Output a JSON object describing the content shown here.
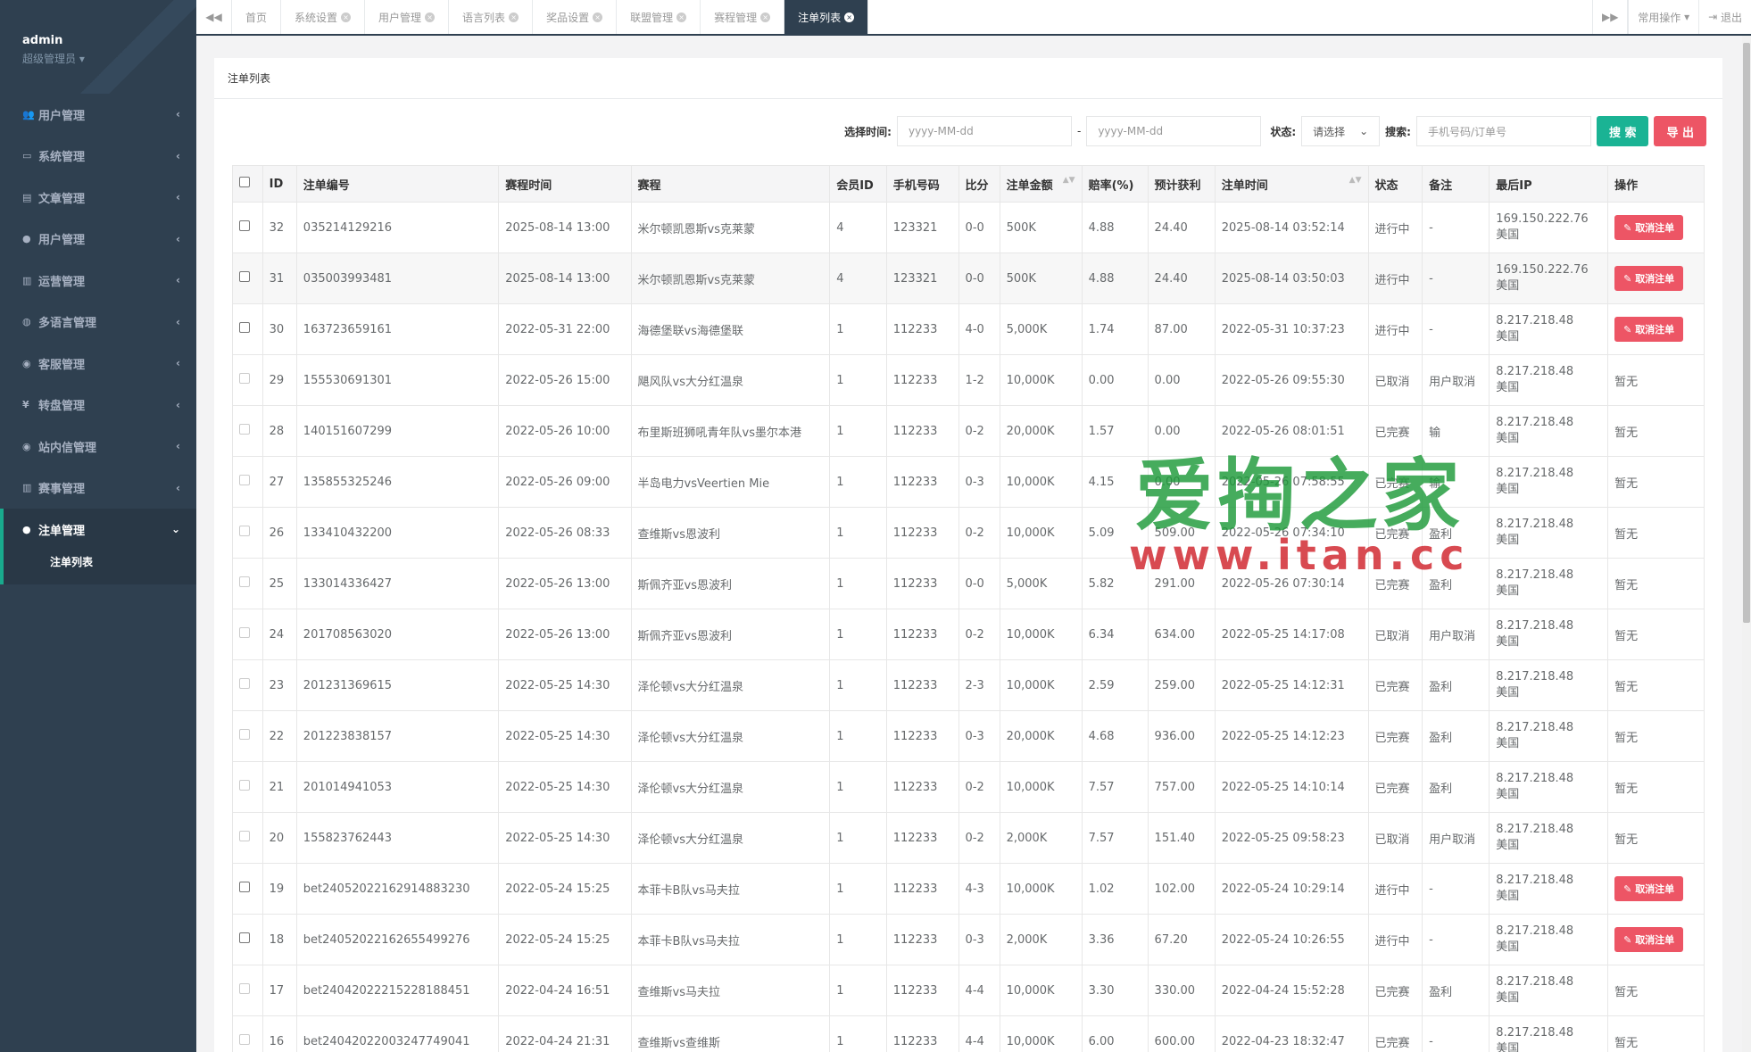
{
  "sidebar": {
    "user": "admin",
    "role": "超级管理员",
    "menu": [
      {
        "label": "用户管理",
        "icon": "users-icon",
        "glyph": "👥"
      },
      {
        "label": "系统管理",
        "icon": "monitor-icon",
        "glyph": "▭"
      },
      {
        "label": "文章管理",
        "icon": "book-icon",
        "glyph": "▤"
      },
      {
        "label": "用户管理",
        "icon": "user-icon",
        "glyph": "●"
      },
      {
        "label": "运营管理",
        "icon": "bar-chart-icon",
        "glyph": "▥"
      },
      {
        "label": "多语言管理",
        "icon": "globe-icon",
        "glyph": "◍"
      },
      {
        "label": "客服管理",
        "icon": "comment-icon",
        "glyph": "◉"
      },
      {
        "label": "转盘管理",
        "icon": "yen-icon",
        "glyph": "¥"
      },
      {
        "label": "站内信管理",
        "icon": "comment-icon",
        "glyph": "◉"
      },
      {
        "label": "赛事管理",
        "icon": "bar-chart-icon",
        "glyph": "▥"
      },
      {
        "label": "注单管理",
        "icon": "user-icon",
        "glyph": "●",
        "active": true
      }
    ],
    "submenu": [
      "注单列表"
    ]
  },
  "tabs": [
    {
      "label": "首页",
      "closable": false
    },
    {
      "label": "系统设置",
      "closable": true
    },
    {
      "label": "用户管理",
      "closable": true
    },
    {
      "label": "语言列表",
      "closable": true
    },
    {
      "label": "奖品设置",
      "closable": true
    },
    {
      "label": "联盟管理",
      "closable": true
    },
    {
      "label": "赛程管理",
      "closable": true
    },
    {
      "label": "注单列表",
      "closable": true,
      "active": true
    }
  ],
  "topbar": {
    "ops_label": "常用操作",
    "logout_label": "退出"
  },
  "panel": {
    "title": "注单列表"
  },
  "filter": {
    "time_label": "选择时间:",
    "date_placeholder": "yyyy-MM-dd",
    "dash": "-",
    "status_label": "状态:",
    "status_value": "请选择",
    "search_label": "搜索:",
    "search_placeholder": "手机号码/订单号",
    "search_button": "搜 索",
    "export_button": "导 出"
  },
  "table": {
    "headers": [
      "ID",
      "注单编号",
      "赛程时间",
      "赛程",
      "会员ID",
      "手机号码",
      "比分",
      "注单金额",
      "赔率(%)",
      "预计获利",
      "注单时间",
      "状态",
      "备注",
      "最后IP",
      "操作"
    ],
    "cancel_label": "取消注单",
    "rows": [
      {
        "id": "32",
        "no": "035214129216",
        "match_time": "2025-08-14 13:00",
        "match": "米尔顿凯恩斯vs克莱蒙",
        "member": "4",
        "phone": "123321",
        "score": "0-0",
        "amount": "500K",
        "odds": "4.88",
        "profit": "24.40",
        "bet_time": "2025-08-14 03:52:14",
        "status": "进行中",
        "note": "-",
        "ip": "169.150.222.76",
        "region": "美国",
        "action": "cancel"
      },
      {
        "id": "31",
        "no": "035003993481",
        "match_time": "2025-08-14 13:00",
        "match": "米尔顿凯恩斯vs克莱蒙",
        "member": "4",
        "phone": "123321",
        "score": "0-0",
        "amount": "500K",
        "odds": "4.88",
        "profit": "24.40",
        "bet_time": "2025-08-14 03:50:03",
        "status": "进行中",
        "note": "-",
        "ip": "169.150.222.76",
        "region": "美国",
        "action": "cancel"
      },
      {
        "id": "30",
        "no": "163723659161",
        "match_time": "2022-05-31 22:00",
        "match": "海德堡联vs海德堡联",
        "member": "1",
        "phone": "112233",
        "score": "4-0",
        "amount": "5,000K",
        "odds": "1.74",
        "profit": "87.00",
        "bet_time": "2022-05-31 10:37:23",
        "status": "进行中",
        "note": "-",
        "ip": "8.217.218.48",
        "region": "美国",
        "action": "cancel"
      },
      {
        "id": "29",
        "no": "155530691301",
        "match_time": "2022-05-26 15:00",
        "match": "飓风队vs大分红温泉",
        "member": "1",
        "phone": "112233",
        "score": "1-2",
        "amount": "10,000K",
        "odds": "0.00",
        "profit": "0.00",
        "bet_time": "2022-05-26 09:55:30",
        "status": "已取消",
        "note": "用户取消",
        "ip": "8.217.218.48",
        "region": "美国",
        "action": "暂无"
      },
      {
        "id": "28",
        "no": "140151607299",
        "match_time": "2022-05-26 10:00",
        "match": "布里斯班狮吼青年队vs墨尔本港",
        "member": "1",
        "phone": "112233",
        "score": "0-2",
        "amount": "20,000K",
        "odds": "1.57",
        "profit": "0.00",
        "bet_time": "2022-05-26 08:01:51",
        "status": "已完赛",
        "note": "输",
        "ip": "8.217.218.48",
        "region": "美国",
        "action": "暂无"
      },
      {
        "id": "27",
        "no": "135855325246",
        "match_time": "2022-05-26 09:00",
        "match": "半岛电力vsVeertien Mie",
        "member": "1",
        "phone": "112233",
        "score": "0-3",
        "amount": "10,000K",
        "odds": "4.15",
        "profit": "0.00",
        "bet_time": "2022-05-26 07:58:55",
        "status": "已完赛",
        "note": "输",
        "ip": "8.217.218.48",
        "region": "美国",
        "action": "暂无"
      },
      {
        "id": "26",
        "no": "133410432200",
        "match_time": "2022-05-26 08:33",
        "match": "查维斯vs恩波利",
        "member": "1",
        "phone": "112233",
        "score": "0-2",
        "amount": "10,000K",
        "odds": "5.09",
        "profit": "509.00",
        "bet_time": "2022-05-26 07:34:10",
        "status": "已完赛",
        "note": "盈利",
        "ip": "8.217.218.48",
        "region": "美国",
        "action": "暂无"
      },
      {
        "id": "25",
        "no": "133014336427",
        "match_time": "2022-05-26 13:00",
        "match": "斯佩齐亚vs恩波利",
        "member": "1",
        "phone": "112233",
        "score": "0-0",
        "amount": "5,000K",
        "odds": "5.82",
        "profit": "291.00",
        "bet_time": "2022-05-26 07:30:14",
        "status": "已完赛",
        "note": "盈利",
        "ip": "8.217.218.48",
        "region": "美国",
        "action": "暂无"
      },
      {
        "id": "24",
        "no": "201708563020",
        "match_time": "2022-05-26 13:00",
        "match": "斯佩齐亚vs恩波利",
        "member": "1",
        "phone": "112233",
        "score": "0-2",
        "amount": "10,000K",
        "odds": "6.34",
        "profit": "634.00",
        "bet_time": "2022-05-25 14:17:08",
        "status": "已取消",
        "note": "用户取消",
        "ip": "8.217.218.48",
        "region": "美国",
        "action": "暂无"
      },
      {
        "id": "23",
        "no": "201231369615",
        "match_time": "2022-05-25 14:30",
        "match": "泽伦顿vs大分红温泉",
        "member": "1",
        "phone": "112233",
        "score": "2-3",
        "amount": "10,000K",
        "odds": "2.59",
        "profit": "259.00",
        "bet_time": "2022-05-25 14:12:31",
        "status": "已完赛",
        "note": "盈利",
        "ip": "8.217.218.48",
        "region": "美国",
        "action": "暂无"
      },
      {
        "id": "22",
        "no": "201223838157",
        "match_time": "2022-05-25 14:30",
        "match": "泽伦顿vs大分红温泉",
        "member": "1",
        "phone": "112233",
        "score": "0-3",
        "amount": "20,000K",
        "odds": "4.68",
        "profit": "936.00",
        "bet_time": "2022-05-25 14:12:23",
        "status": "已完赛",
        "note": "盈利",
        "ip": "8.217.218.48",
        "region": "美国",
        "action": "暂无"
      },
      {
        "id": "21",
        "no": "201014941053",
        "match_time": "2022-05-25 14:30",
        "match": "泽伦顿vs大分红温泉",
        "member": "1",
        "phone": "112233",
        "score": "0-2",
        "amount": "10,000K",
        "odds": "7.57",
        "profit": "757.00",
        "bet_time": "2022-05-25 14:10:14",
        "status": "已完赛",
        "note": "盈利",
        "ip": "8.217.218.48",
        "region": "美国",
        "action": "暂无"
      },
      {
        "id": "20",
        "no": "155823762443",
        "match_time": "2022-05-25 14:30",
        "match": "泽伦顿vs大分红温泉",
        "member": "1",
        "phone": "112233",
        "score": "0-2",
        "amount": "2,000K",
        "odds": "7.57",
        "profit": "151.40",
        "bet_time": "2022-05-25 09:58:23",
        "status": "已取消",
        "note": "用户取消",
        "ip": "8.217.218.48",
        "region": "美国",
        "action": "暂无"
      },
      {
        "id": "19",
        "no": "bet24052022162914883230",
        "match_time": "2022-05-24 15:25",
        "match": "本菲卡B队vs马夫拉",
        "member": "1",
        "phone": "112233",
        "score": "4-3",
        "amount": "10,000K",
        "odds": "1.02",
        "profit": "102.00",
        "bet_time": "2022-05-24 10:29:14",
        "status": "进行中",
        "note": "-",
        "ip": "8.217.218.48",
        "region": "美国",
        "action": "cancel"
      },
      {
        "id": "18",
        "no": "bet24052022162655499276",
        "match_time": "2022-05-24 15:25",
        "match": "本菲卡B队vs马夫拉",
        "member": "1",
        "phone": "112233",
        "score": "0-3",
        "amount": "2,000K",
        "odds": "3.36",
        "profit": "67.20",
        "bet_time": "2022-05-24 10:26:55",
        "status": "进行中",
        "note": "-",
        "ip": "8.217.218.48",
        "region": "美国",
        "action": "cancel"
      },
      {
        "id": "17",
        "no": "bet24042022215228188451",
        "match_time": "2022-04-24 16:51",
        "match": "查维斯vs马夫拉",
        "member": "1",
        "phone": "112233",
        "score": "4-4",
        "amount": "10,000K",
        "odds": "3.30",
        "profit": "330.00",
        "bet_time": "2022-04-24 15:52:28",
        "status": "已完赛",
        "note": "盈利",
        "ip": "8.217.218.48",
        "region": "美国",
        "action": "暂无"
      },
      {
        "id": "16",
        "no": "bet24042022003247749041",
        "match_time": "2022-04-24 21:31",
        "match": "查维斯vs查维斯",
        "member": "1",
        "phone": "112233",
        "score": "4-4",
        "amount": "10,000K",
        "odds": "6.00",
        "profit": "600.00",
        "bet_time": "2022-04-23 18:32:47",
        "status": "已完赛",
        "note": "-",
        "ip": "8.217.218.48",
        "region": "美国",
        "action": "暂无"
      }
    ]
  },
  "watermark": {
    "cn": "爱掏之家",
    "url": "www.itan.cc"
  }
}
